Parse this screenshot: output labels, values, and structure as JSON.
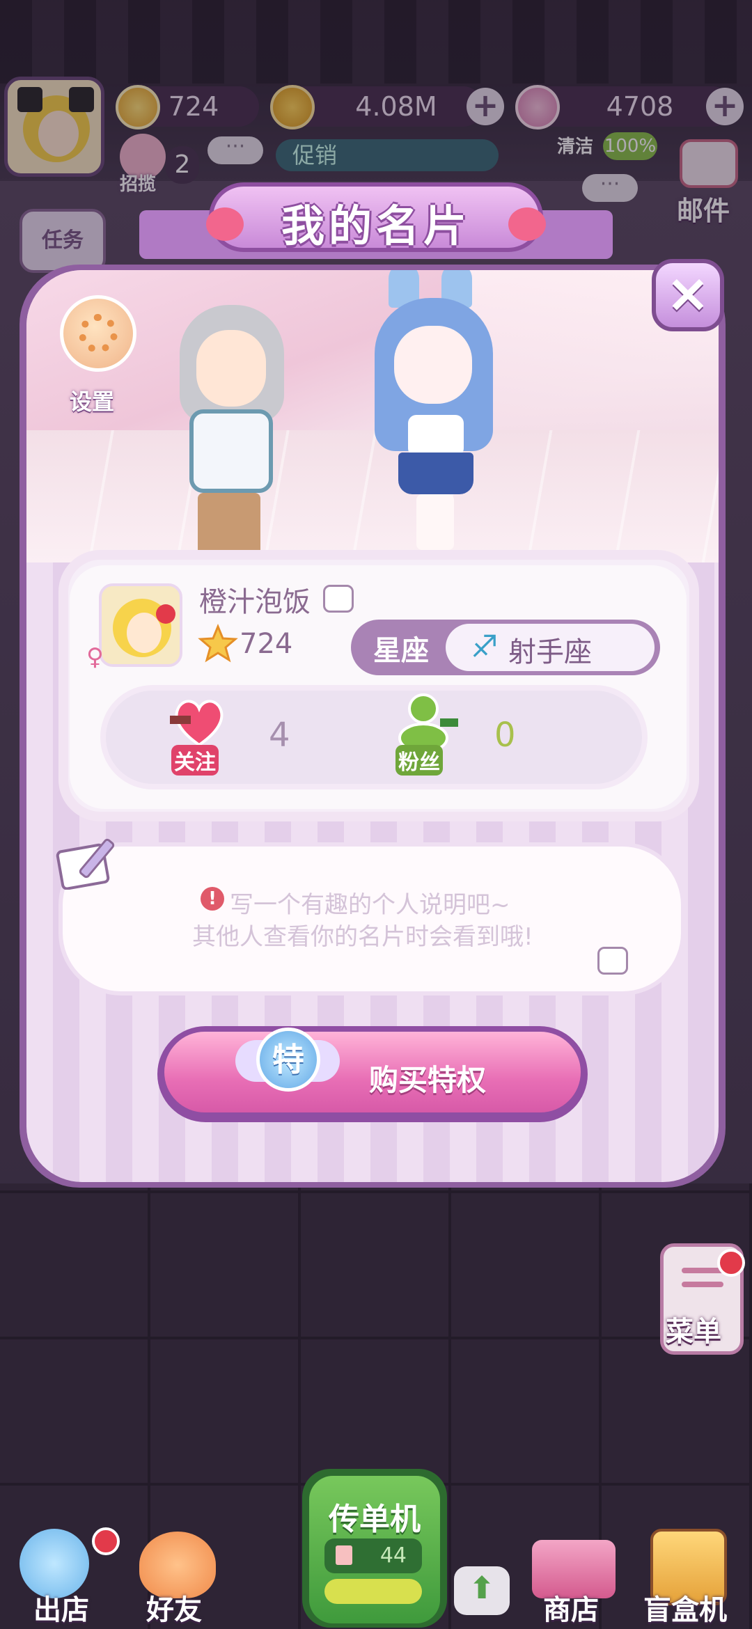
{
  "hud": {
    "level": "724",
    "coins": "4.08M",
    "gems": "4708",
    "recruit_count": "2",
    "recruit_label": "招揽",
    "promo_label": "促销",
    "clean_label": "清洁",
    "clean_percent": "100%",
    "mail_label": "邮件",
    "task_label": "任务"
  },
  "card": {
    "title": "我的名片",
    "settings_label": "设置",
    "close_icon": "×",
    "player_name": "橙汁泡饭",
    "level": "724",
    "zodiac_label": "星座",
    "zodiac_symbol": "♐",
    "zodiac_value": "射手座",
    "follow_label": "关注",
    "follow_count": "4",
    "fans_label": "粉丝",
    "fans_count": "0",
    "bio_placeholder_line1": "写一个有趣的个人说明吧~",
    "bio_placeholder_line2": "其他人查看你的名片时会看到哦!",
    "buy_badge": "特",
    "buy_label": "购买特权"
  },
  "nav": {
    "store_out": "出店",
    "friends": "好友",
    "flyer": "传单机",
    "flyer_count": "44",
    "shop": "商店",
    "blindbox": "盲盒机",
    "menu": "菜单"
  },
  "colors": {
    "frame": "#8f5fa0",
    "accent_pink": "#e86eb5",
    "follow_red": "#e0426a",
    "fans_green": "#6fa63a"
  }
}
